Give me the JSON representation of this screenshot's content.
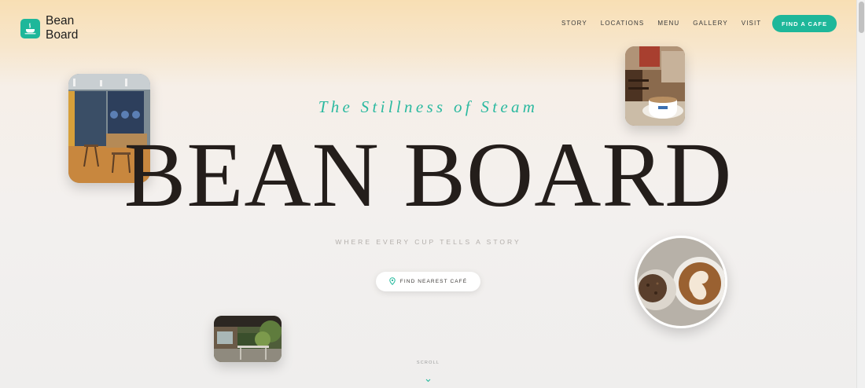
{
  "brand": {
    "line1": "Bean",
    "line2": "Board",
    "accent_color": "#1eb79a"
  },
  "nav": {
    "items": [
      "STORY",
      "LOCATIONS",
      "MENU",
      "GALLERY",
      "VISIT"
    ],
    "cta_label": "FIND A CAFE"
  },
  "hero": {
    "tagline": "The Stillness of Steam",
    "title": "BEAN BOARD",
    "subtitle": "WHERE EVERY CUP TELLS A STORY",
    "cta_label": "FIND NEAREST CAFÉ",
    "cta_icon": "map-pin-icon",
    "scroll_label": "SCROLL",
    "scroll_icon": "chevron-down-icon"
  },
  "photos": [
    {
      "name": "cafe-interior-photo"
    },
    {
      "name": "coffee-cup-photo"
    },
    {
      "name": "latte-art-photo"
    },
    {
      "name": "outdoor-terrace-photo"
    }
  ],
  "colors": {
    "title": "#241e1b",
    "tagline": "#2bb9a0",
    "header_gradient": "#f8dfb4"
  }
}
